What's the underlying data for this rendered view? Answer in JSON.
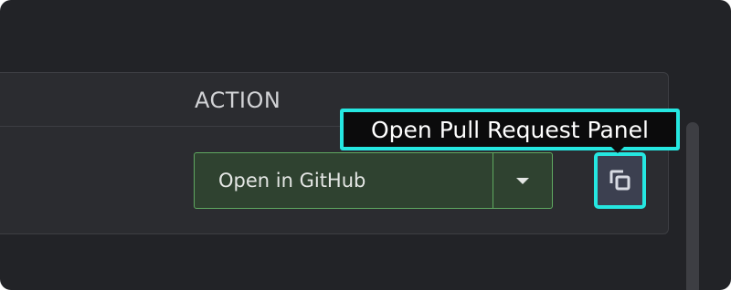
{
  "table": {
    "columns": {
      "action": "ACTION"
    }
  },
  "row": {
    "primary_button_label": "Open in GitHub",
    "dropdown_icon": "chevron-down-icon",
    "copy_icon": "copy-icon"
  },
  "tooltip": {
    "text": "Open Pull Request Panel"
  },
  "colors": {
    "background": "#222327",
    "card": "#2b2c30",
    "button_fill": "#2f4230",
    "button_border": "#5fa860",
    "highlight": "#25e7e1",
    "tooltip_bg": "#0b0b0c"
  }
}
